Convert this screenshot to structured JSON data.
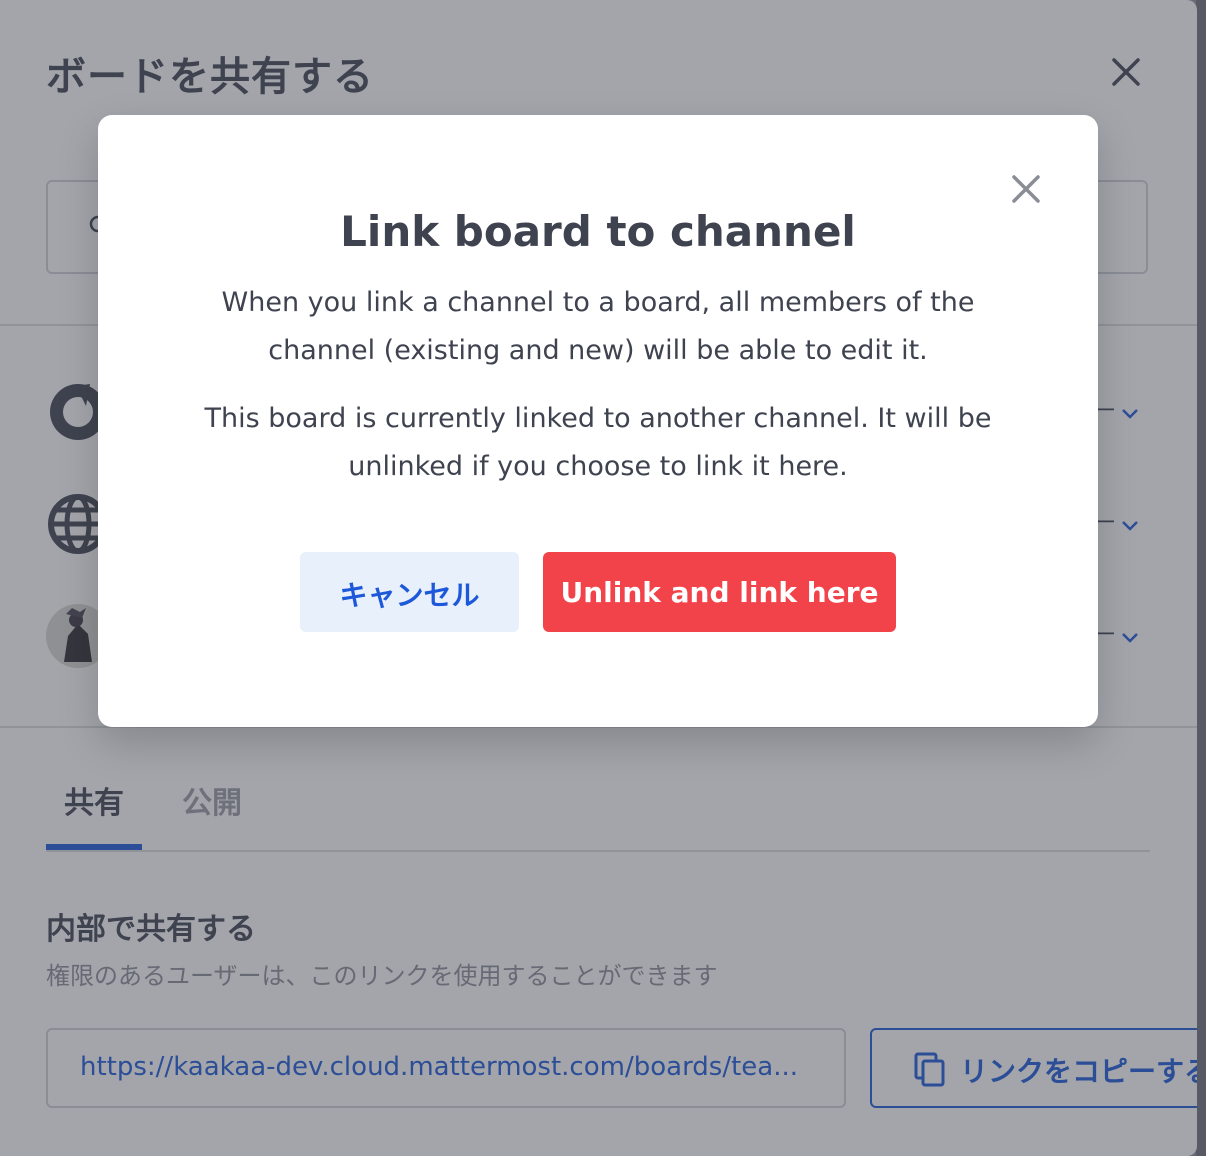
{
  "share_dialog": {
    "title": "ボードを共有する",
    "member_rows": [
      {
        "icon": "mattermost-logo-icon",
        "role_suffix": "ー"
      },
      {
        "icon": "globe-icon",
        "role_suffix": "ー"
      },
      {
        "icon": "avatar",
        "role_suffix": "ー"
      }
    ],
    "tabs": [
      {
        "label": "共有",
        "active": true
      },
      {
        "label": "公開",
        "active": false
      }
    ],
    "section_title": "内部で共有する",
    "section_description": "権限のあるユーザーは、このリンクを使用することができます",
    "link_value": "https://kaakaa-dev.cloud.mattermost.com/boards/tea...",
    "copy_button_label": "リンクをコピーする"
  },
  "link_dialog": {
    "title": "Link board to channel",
    "body_paragraph_1": "When you link a channel to a board, all members of the channel (existing and new) will be able to edit it.",
    "body_paragraph_2": "This board is currently linked to another channel. It will be unlinked if you choose to link it here.",
    "cancel_label": "キャンセル",
    "confirm_label": "Unlink and link here"
  },
  "colors": {
    "accent_blue": "#1c58d9",
    "danger_red": "#f2434a",
    "text_dark": "#3f4350"
  }
}
